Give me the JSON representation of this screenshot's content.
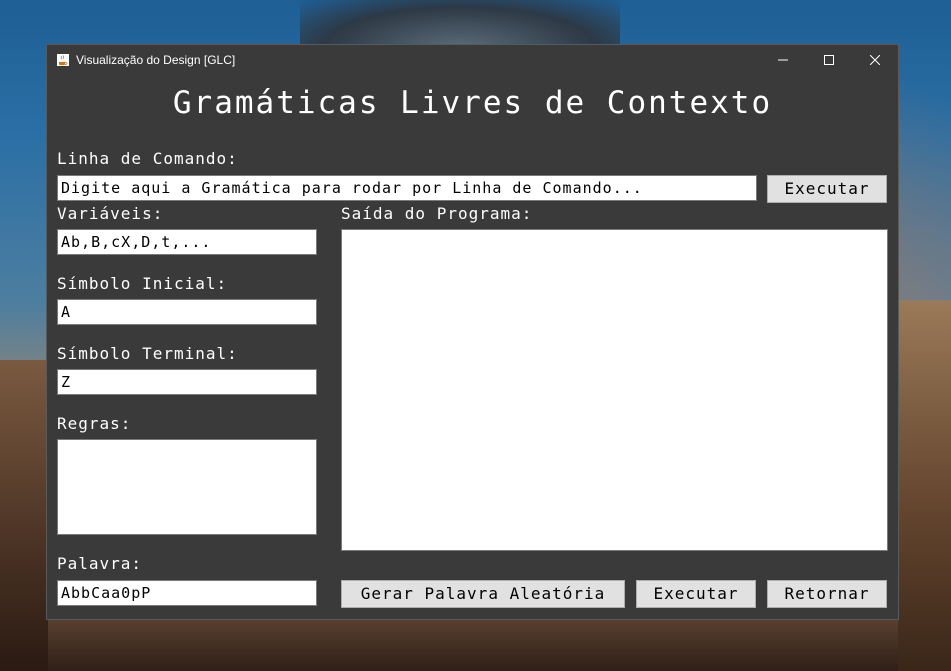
{
  "window": {
    "title": "Visualização do Design [GLC]"
  },
  "heading": "Gramáticas Livres de Contexto",
  "command_line": {
    "label": "Linha de Comando:",
    "value": "Digite aqui a Gramática para rodar por Linha de Comando...",
    "execute_label": "Executar"
  },
  "variables": {
    "label": "Variáveis:",
    "value": "Ab,B,cX,D,t,..."
  },
  "start_symbol": {
    "label": "Símbolo Inicial:",
    "value": "A"
  },
  "terminal_symbol": {
    "label": "Símbolo Terminal:",
    "value": "Z"
  },
  "rules": {
    "label": "Regras:",
    "value": ""
  },
  "word": {
    "label": "Palavra:",
    "value": "AbbCaa0pP"
  },
  "output": {
    "label": "Saída do Programa:",
    "value": ""
  },
  "buttons": {
    "random_word": "Gerar Palavra Aleatória",
    "execute": "Executar",
    "back": "Retornar"
  }
}
